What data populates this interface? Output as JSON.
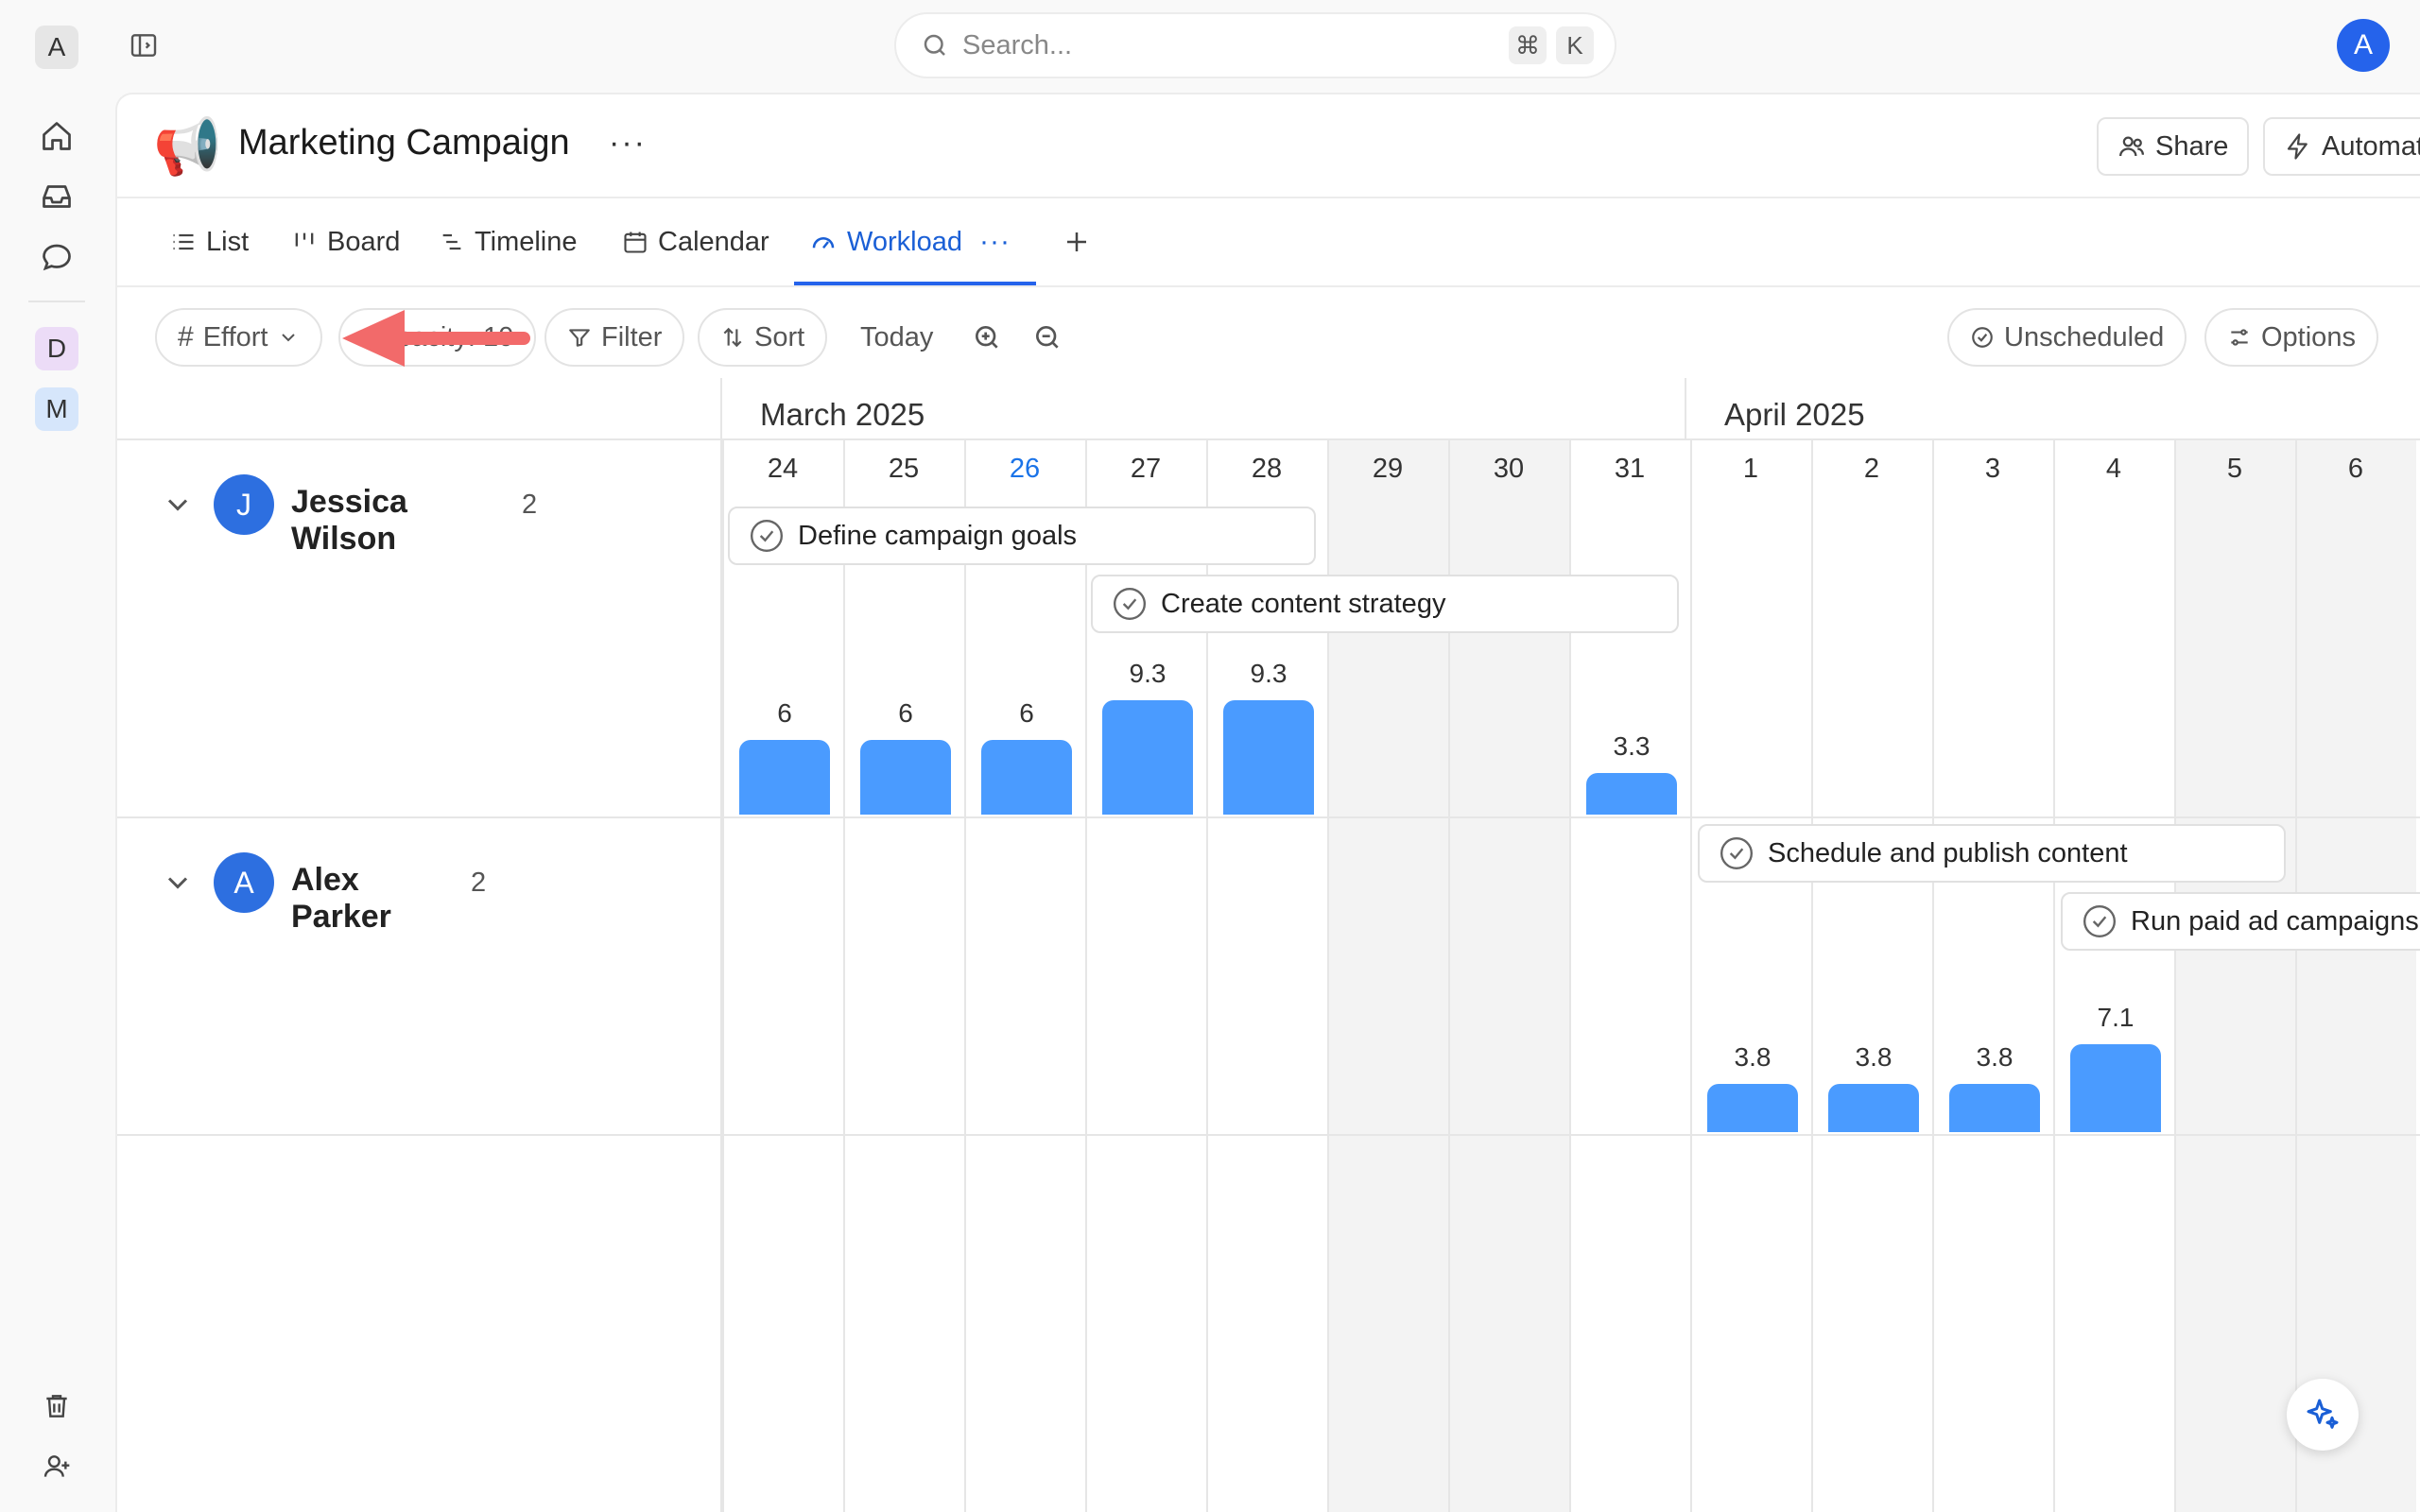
{
  "rail": {
    "workspace_initial": "A",
    "spaces": [
      "D",
      "M"
    ]
  },
  "search": {
    "placeholder": "Search...",
    "shortcut_key": "⌘",
    "shortcut_letter": "K"
  },
  "user": {
    "initial": "A"
  },
  "project": {
    "title": "Marketing Campaign",
    "more": "···"
  },
  "header_buttons": {
    "share": "Share",
    "automations": "Automations"
  },
  "tabs": [
    {
      "label": "List",
      "icon": "list-icon"
    },
    {
      "label": "Board",
      "icon": "board-icon"
    },
    {
      "label": "Timeline",
      "icon": "timeline-icon"
    },
    {
      "label": "Calendar",
      "icon": "calendar-icon"
    },
    {
      "label": "Workload",
      "icon": "gauge-icon",
      "active": true
    }
  ],
  "toolbar": {
    "effort": "Effort",
    "capacity": "Capacity: 10",
    "filter": "Filter",
    "sort": "Sort",
    "today": "Today",
    "unscheduled": "Unscheduled",
    "options": "Options"
  },
  "months": [
    "March 2025",
    "April 2025"
  ],
  "days": [
    {
      "num": "24",
      "weekend": false,
      "today": false
    },
    {
      "num": "25",
      "weekend": false,
      "today": false
    },
    {
      "num": "26",
      "weekend": false,
      "today": true
    },
    {
      "num": "27",
      "weekend": false,
      "today": false
    },
    {
      "num": "28",
      "weekend": false,
      "today": false
    },
    {
      "num": "29",
      "weekend": true,
      "today": false
    },
    {
      "num": "30",
      "weekend": true,
      "today": false
    },
    {
      "num": "31",
      "weekend": false,
      "today": false
    },
    {
      "num": "1",
      "weekend": false,
      "today": false
    },
    {
      "num": "2",
      "weekend": false,
      "today": false
    },
    {
      "num": "3",
      "weekend": false,
      "today": false
    },
    {
      "num": "4",
      "weekend": false,
      "today": false
    },
    {
      "num": "5",
      "weekend": true,
      "today": false
    },
    {
      "num": "6",
      "weekend": true,
      "today": false
    }
  ],
  "people": [
    {
      "name": "Jessica Wilson",
      "initial": "J",
      "count": "2",
      "tasks": [
        "Define campaign goals",
        "Create content strategy"
      ],
      "workload": [
        "6",
        "6",
        "6",
        "9.3",
        "9.3",
        "",
        "",
        "3.3",
        "",
        "",
        "",
        "",
        "",
        ""
      ]
    },
    {
      "name": "Alex Parker",
      "initial": "A",
      "count": "2",
      "tasks": [
        "Schedule and publish content",
        "Run paid ad campaigns"
      ],
      "workload": [
        "",
        "",
        "",
        "",
        "",
        "",
        "",
        "",
        "3.8",
        "3.8",
        "3.8",
        "7.1",
        "",
        ""
      ]
    }
  ],
  "colors": {
    "accent": "#2563eb",
    "bar": "#4a9bff",
    "weekend": "#f3f3f3",
    "arrow": "#f26a6a"
  }
}
